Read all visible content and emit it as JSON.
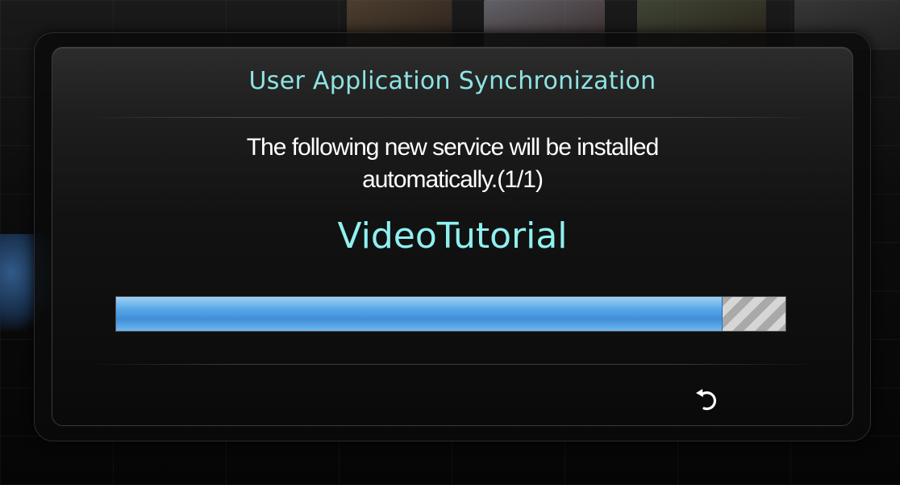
{
  "dialog": {
    "title": "User Application Synchronization",
    "message": "The following new service will be installed automatically.(1/1)",
    "message_line1": "The following new service will be installed",
    "message_line2": "automatically.(1/1)",
    "service_name": "VideoTutorial",
    "progress": {
      "fraction": 0.905
    },
    "return_icon": "return-arrow-icon"
  },
  "colors": {
    "title": "#8fe3e3",
    "service_name": "#8ff0f0",
    "progress_fill": "#4a9be0"
  }
}
